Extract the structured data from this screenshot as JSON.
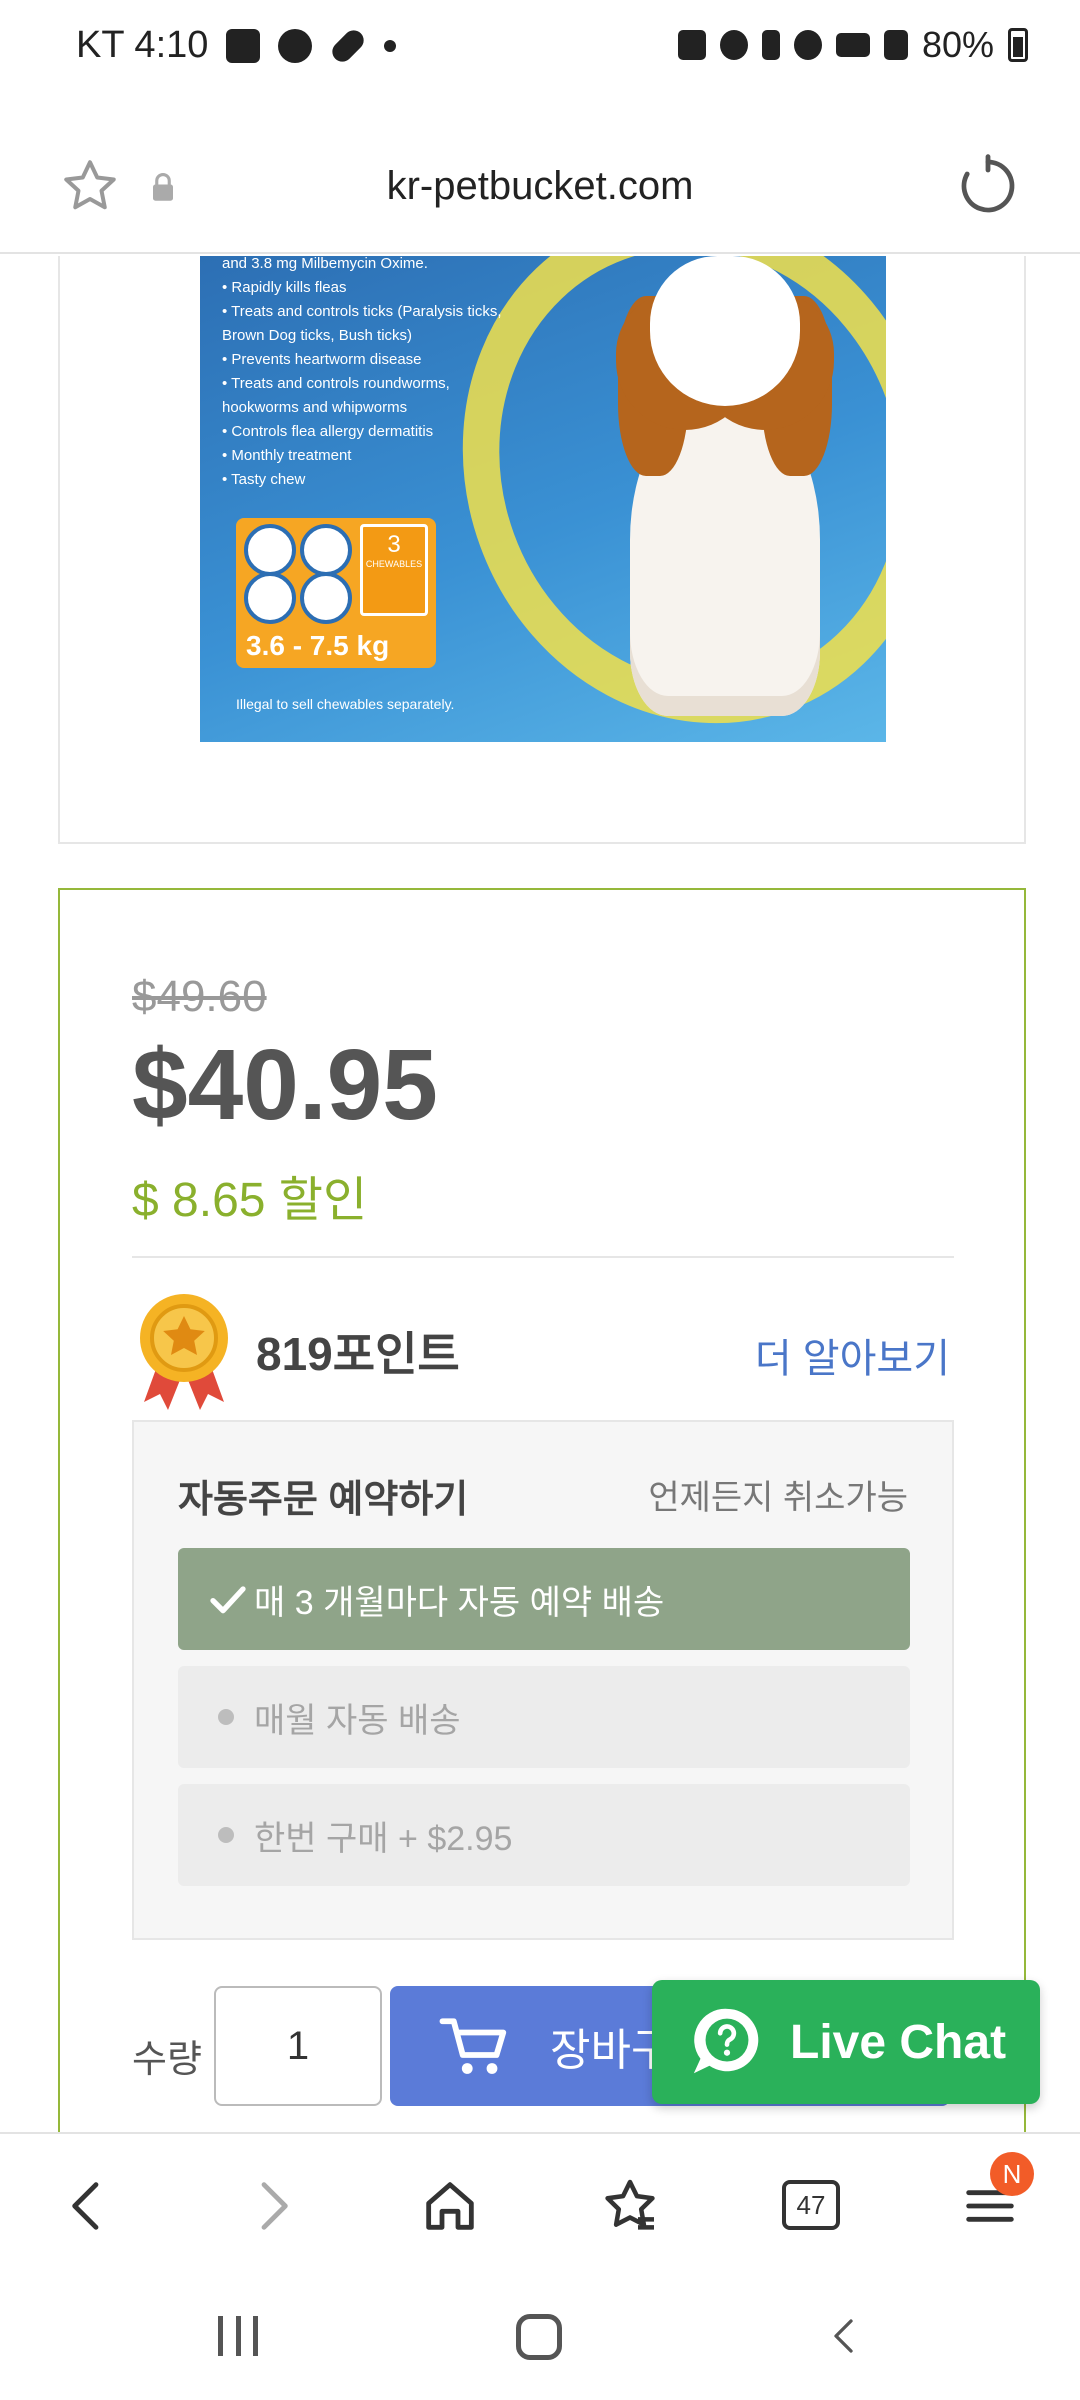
{
  "status_bar": {
    "carrier_time": "KT 4:10",
    "battery": "80%"
  },
  "url_bar": {
    "domain": "kr-petbucket.com"
  },
  "product_image": {
    "package_text": [
      "and 3.8 mg Milbemycin Oxime.",
      "• Rapidly kills fleas",
      "• Treats and controls ticks (Paralysis ticks,",
      "  Brown Dog ticks, Bush ticks)",
      "• Prevents heartworm disease",
      "• Treats and controls roundworms,",
      "  hookworms and whipworms",
      "• Controls flea allergy dermatitis",
      "• Monthly treatment",
      "• Tasty chew"
    ],
    "chewables_count": "3",
    "chewables_label": "CHEWABLES",
    "weight_range": "3.6 - 7.5 kg",
    "legal_note": "Illegal to sell chewables separately."
  },
  "pricing": {
    "original_price": "$49.60",
    "sale_price": "$40.95",
    "discount_text": "$ 8.65 할인"
  },
  "points": {
    "label": "819포인트",
    "learn_more": "더 알아보기"
  },
  "auto_order": {
    "title": "자동주문 예약하기",
    "cancel_note": "언제든지 취소가능",
    "options": [
      {
        "label": "매 3 개월마다 자동 예약 배송",
        "selected": true
      },
      {
        "label": "매월 자동 배송",
        "selected": false
      },
      {
        "label": "한번 구매 + $2.95",
        "selected": false
      }
    ]
  },
  "purchase": {
    "quantity_label": "수량",
    "quantity_value": "1",
    "cart_button_label": "장바구"
  },
  "live_chat": {
    "label": "Live Chat"
  },
  "browser_bar": {
    "tab_count": "47",
    "menu_badge": "N"
  },
  "colors": {
    "accent_green": "#8ab02d",
    "card_border": "#95b83a",
    "selected_option": "#8fa489",
    "cart_blue": "#5b7bd8",
    "chat_green": "#2ab15a",
    "link_blue": "#4a76c8"
  }
}
